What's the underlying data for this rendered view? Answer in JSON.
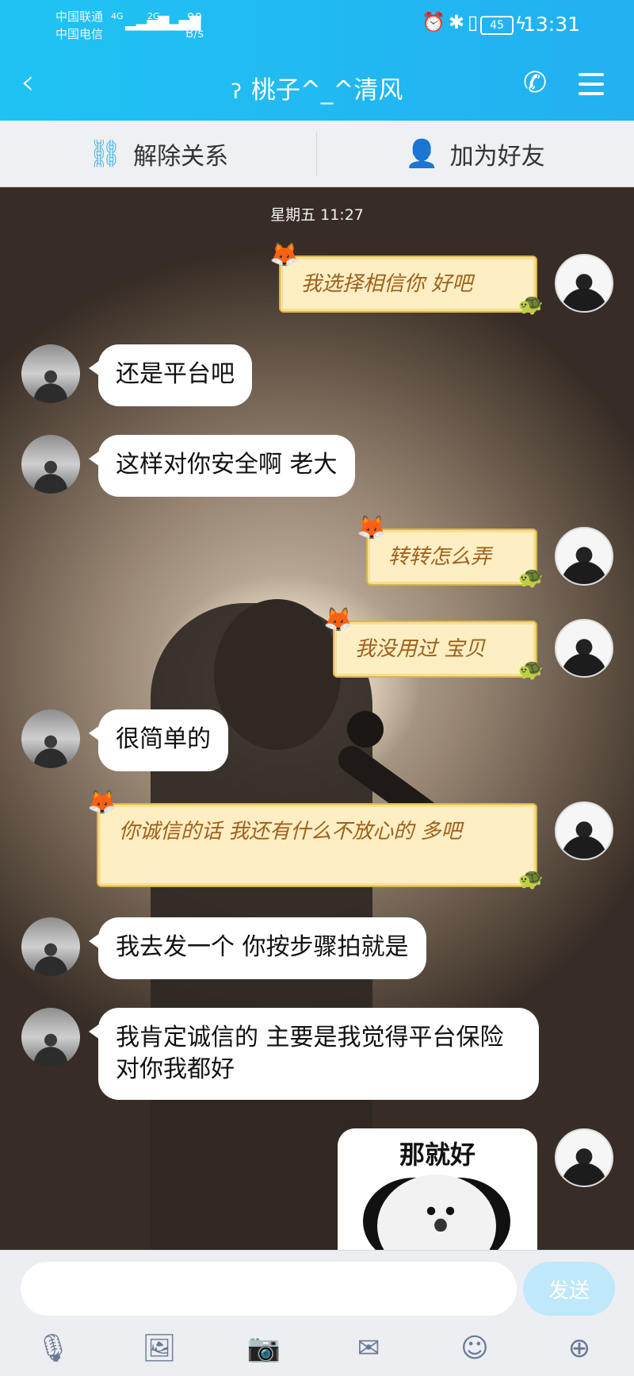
{
  "status_bar": {
    "carrier_1": "中国联通",
    "carrier_2": "中国电信",
    "signal_1": "4G",
    "signal_2": "2G",
    "net_speed_value": "90",
    "net_speed_unit": "B/s",
    "battery": "45",
    "time": "13:31"
  },
  "header": {
    "back_icon": "chevron-left-icon",
    "title": "桃子^_^清风",
    "title_icon": "ear-icon",
    "call_icon": "phone-icon",
    "menu_icon": "menu-icon"
  },
  "actions": {
    "unlink_label": "解除关系",
    "add_friend_label": "加为好友"
  },
  "chat": {
    "timestamp": "星期五 11:27",
    "messages": [
      {
        "from": "self",
        "style": "scroll",
        "text": "我选择相信你 好吧"
      },
      {
        "from": "peer",
        "text": "还是平台吧"
      },
      {
        "from": "peer",
        "text": "这样对你安全啊 老大"
      },
      {
        "from": "self",
        "style": "scroll",
        "text": "转转怎么弄"
      },
      {
        "from": "self",
        "style": "scroll",
        "text": "我没用过 宝贝"
      },
      {
        "from": "peer",
        "text": "很简单的"
      },
      {
        "from": "self",
        "style": "scroll",
        "text": "你诚信的话 我还有什么不放心的 多吧"
      },
      {
        "from": "peer",
        "text": "我去发一个 你按步骤拍就是"
      },
      {
        "from": "peer",
        "text": "我肯定诚信的 主要是我觉得平台保险 对你我都好"
      },
      {
        "from": "self",
        "style": "sticker",
        "text": "那就好"
      }
    ]
  },
  "composer": {
    "input_value": "",
    "send_label": "发送",
    "tools": [
      "microphone-icon",
      "image-icon",
      "camera-icon",
      "red-packet-icon",
      "emoji-icon",
      "plus-icon"
    ]
  },
  "colors": {
    "header_blue": "#22b8f2",
    "send_disabled": "#bfe8fb",
    "scroll_text": "#a0601a"
  }
}
